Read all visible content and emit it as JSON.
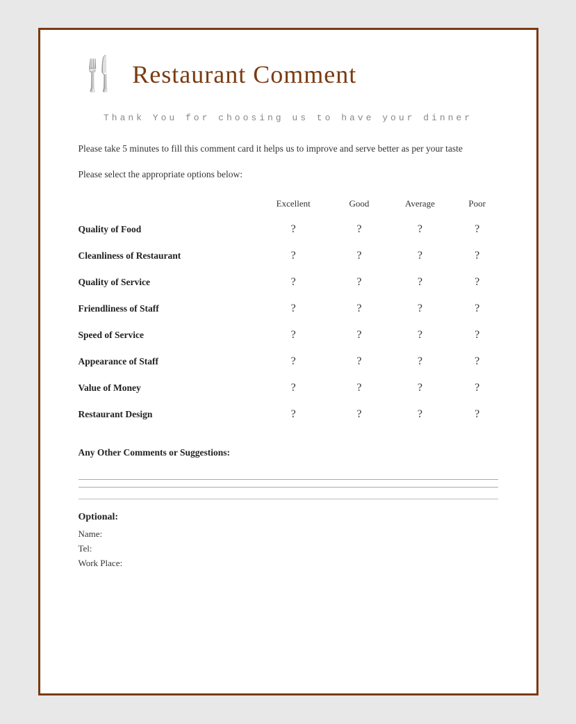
{
  "header": {
    "icon": "🍴",
    "title": "Restaurant Comment"
  },
  "thank_you": "Thank You for choosing us to have your\ndinner",
  "description": "Please take 5 minutes to fill this comment card it helps us to improve and serve better as per your taste",
  "instruction": "Please select the appropriate options below:",
  "table": {
    "columns": [
      "",
      "Excellent",
      "Good",
      "Average",
      "Poor"
    ],
    "rows": [
      {
        "label": "Quality of Food",
        "excellent": "?",
        "good": "?",
        "average": "?",
        "poor": "?"
      },
      {
        "label": "Cleanliness of Restaurant",
        "excellent": "?",
        "good": "?",
        "average": "?",
        "poor": "?"
      },
      {
        "label": "Quality of Service",
        "excellent": "?",
        "good": "?",
        "average": "?",
        "poor": "?"
      },
      {
        "label": "Friendliness of Staff",
        "excellent": "?",
        "good": "?",
        "average": "?",
        "poor": "?"
      },
      {
        "label": "Speed of Service",
        "excellent": "?",
        "good": "?",
        "average": "?",
        "poor": "?"
      },
      {
        "label": "Appearance of Staff",
        "excellent": "?",
        "good": "?",
        "average": "?",
        "poor": "?"
      },
      {
        "label": "Value of Money",
        "excellent": "?",
        "good": "?",
        "average": "?",
        "poor": "?"
      },
      {
        "label": "Restaurant Design",
        "excellent": "?",
        "good": "?",
        "average": "?",
        "poor": "?"
      }
    ]
  },
  "comments": {
    "label": "Any Other Comments or Suggestions:"
  },
  "optional": {
    "label": "Optional:",
    "fields": [
      "Name:",
      "Tel:",
      "Work Place:"
    ]
  }
}
